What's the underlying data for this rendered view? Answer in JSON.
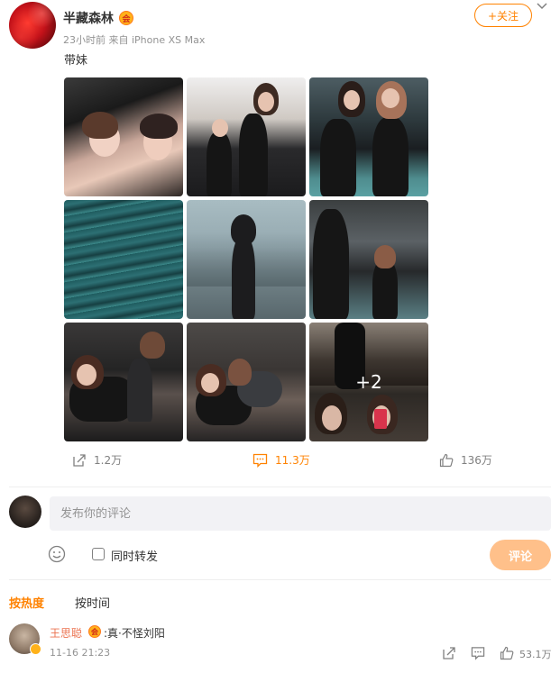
{
  "post": {
    "username": "半藏森林",
    "vip_badge": "会",
    "meta": "23小时前  来自 iPhone XS Max",
    "text": "带妹",
    "follow_label": "+关注",
    "more_photos": "+2"
  },
  "actions": {
    "repost_count": "1.2万",
    "comment_count": "11.3万",
    "like_count": "136万"
  },
  "composer": {
    "placeholder": "发布你的评论",
    "repost_label": "同时转发",
    "submit_label": "评论"
  },
  "sort": {
    "hot": "按热度",
    "time": "按时间"
  },
  "comment": {
    "name": "王思聪",
    "badge": "会",
    "text": ":真·不怪刘阳",
    "time": "11-16 21:23",
    "likes": "53.1万"
  },
  "colors": {
    "accent": "#ff8200",
    "comment_name": "#eb7350",
    "muted": "#939393"
  },
  "icons": [
    "dropdown-icon",
    "repost-icon",
    "comment-icon",
    "like-icon",
    "emoji-icon",
    "checkbox"
  ]
}
